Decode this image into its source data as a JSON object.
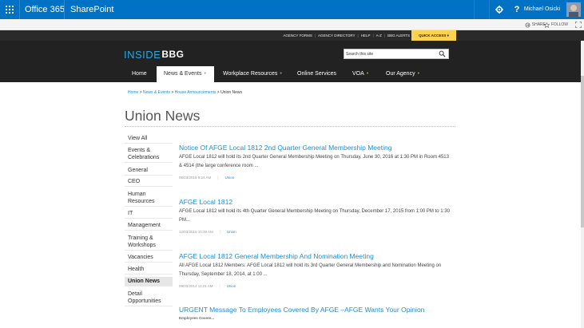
{
  "o365": {
    "app_launcher_icon": "waffle-icon",
    "app_name": "Office 365",
    "site_name": "SharePoint",
    "settings_icon": "gear-icon",
    "help_label": "?",
    "user_name": "Michael Osicki"
  },
  "suite_actions": {
    "share": "SHARE",
    "follow": "FOLLOW"
  },
  "utility": {
    "links": [
      "AGENCY FORMS",
      "AGENCY DIRECTORY",
      "HELP",
      "A-Z",
      "BBG ALERTS"
    ],
    "quick_access": "QUICK ACCESS"
  },
  "header": {
    "logo_text": "INSIDE",
    "logo_mark": "BBG",
    "search_placeholder": "Search this site"
  },
  "nav": {
    "items": [
      {
        "label": "Home"
      },
      {
        "label": "News & Events",
        "active": true
      },
      {
        "label": "Workplace Resources"
      },
      {
        "label": "Online Services"
      },
      {
        "label": "VOA"
      },
      {
        "label": "Our Agency"
      }
    ]
  },
  "breadcrumb": {
    "home": "Home",
    "news": "News & Events",
    "house": "House Announcements",
    "current": "Union News",
    "sep": ">"
  },
  "page": {
    "title": "Union News"
  },
  "categories": [
    "View All",
    "Events & Celebrations",
    "General",
    "CEO",
    "Human Resources",
    "IT",
    "Management",
    "Training & Workshops",
    "Vacancies",
    "Health",
    "Union News",
    "Detail Opportunities"
  ],
  "selected_category": "Union News",
  "articles": [
    {
      "title": "Notice Of AFGE Local 1812 2nd Quarter General Membership Meeting",
      "body": "AFGE Local 1812 will hold its 2nd Quarter General Membership Meeting on Thursday, June 30, 2016 at 1:30 PM in Room 4513 & 4514 (the large conference room ...",
      "date": "06/23/2016 9:24 AM",
      "tag": "Union"
    },
    {
      "title": "AFGE Local 1812",
      "body": "AFGE Local 1812 will hold its 4th Quarter General Membership Meeting on Thursday, December 17, 2015 from 1:00 PM to 1:30 PM...",
      "date": "12/03/2015 10:39 AM",
      "tag": "Union"
    },
    {
      "title": "AFGE Local 1812 General Membership And Nomination Meeting",
      "body": "All AFGE Local 1812 Members: AFGE Local 1812 will hold its 3rd Quarter General Membership and Nomination Meeting on Thursday, September 18, 2014, at 1:00 ...",
      "date": "09/03/2014 11:21 AM",
      "tag": "Union"
    },
    {
      "title": "URGENT Message To Employees Covered By AFGE –AFGE Wants Your Opinion",
      "body": "Employees Covere..."
    }
  ],
  "colors": {
    "suite_bar": "#0072c6",
    "header": "#222222",
    "accent_link": "#1a8fd4",
    "quick_access": "#ffd24d",
    "nav_dot": "#7db94a"
  }
}
